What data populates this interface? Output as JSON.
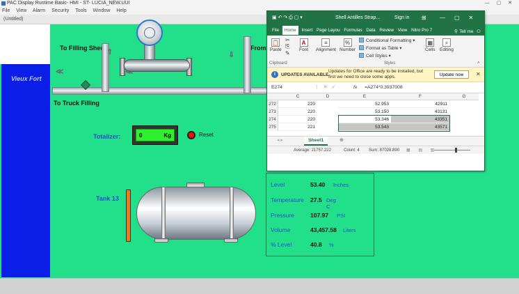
{
  "pac": {
    "title": "PAC Display Runtime Basic- HMI - ST- LUCIA_NEW.UUI",
    "menu": [
      "File",
      "View",
      "Alarm",
      "Security",
      "Tools",
      "Window",
      "Help"
    ],
    "doc_tab": "(Untitled)"
  },
  "hmi": {
    "to_filling_shed": "To Filling Shed",
    "from_label": "From",
    "to_truck_filling": "To Truck Filling",
    "vieux_fort": "Vieux Fort",
    "totalizer_label": "Totalizer:",
    "totalizer_value": "0",
    "totalizer_unit": "Kg",
    "reset_label": "Reset",
    "tank_label": "Tank 13"
  },
  "readings": [
    {
      "label": "Level",
      "value": "53.40",
      "unit": "Inches"
    },
    {
      "label": "Temperature",
      "value": "27.5",
      "unit": "Deg C"
    },
    {
      "label": "Pressure",
      "value": "107.97",
      "unit": "PSI"
    },
    {
      "label": "Volume",
      "value": "43,457.58",
      "unit": "Liters"
    },
    {
      "label": "% Level",
      "value": "40.8",
      "unit": "%"
    }
  ],
  "excel": {
    "file_name": "Shell Antilles Strap...",
    "sign_in": "Sign in",
    "tabs": [
      "File",
      "Home",
      "Insert",
      "Page Layou",
      "Formulas",
      "Data",
      "Review",
      "View",
      "Nitro Pro 7"
    ],
    "tell_me": "Tell me",
    "ribbon": {
      "paste": "Paste",
      "font": "Font",
      "alignment": "Alignment",
      "number": "Number",
      "conditional_formatting": "Conditional Formatting",
      "format_as_table": "Format as Table",
      "cell_styles": "Cell Styles",
      "cells": "Cells",
      "editing": "Editing",
      "clipboard": "Clipboard",
      "styles": "Styles"
    },
    "update_bar": {
      "title": "UPDATES AVAILABLE",
      "message": "Updates for Office are ready to be installed, but first we need to close some apps.",
      "button": "Update now"
    },
    "name_box": "E274",
    "formula": "=A274*0.3937008",
    "columns": [
      "C",
      "D",
      "E",
      "F",
      "G"
    ],
    "rows": [
      {
        "row": "272",
        "c": "220",
        "e": "52.953",
        "f": "42911"
      },
      {
        "row": "273",
        "c": "220",
        "e": "53.150",
        "f": "43131"
      },
      {
        "row": "274",
        "c": "220",
        "e": "53.346",
        "f": "43351"
      },
      {
        "row": "275",
        "c": "221",
        "e": "53.543",
        "f": "43571"
      }
    ],
    "sheet_tab": "Sheet1",
    "status": {
      "average": "Average: 21757.222",
      "count": "Count: 4",
      "sum": "Sum: 87028.890"
    }
  },
  "colors": {
    "hmi_bg": "#22e08a",
    "vieux_fort_bg": "#0a1ee8",
    "excel_green": "#217346",
    "label_blue": "#1f4fcf",
    "gauge_orange": "#f07a1a"
  }
}
